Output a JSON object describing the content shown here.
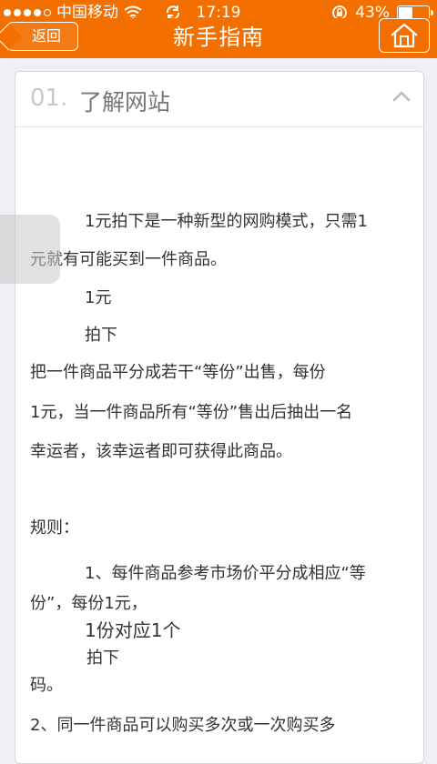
{
  "status_bar": {
    "carrier": "中国移动",
    "time": "17:19",
    "battery": "43%",
    "battery_level": 0.43
  },
  "navbar": {
    "back_label": "返回",
    "title": "新手指南",
    "home_icon": "home-icon"
  },
  "section": {
    "number": "01.",
    "title": "了解网站",
    "toggle_icon": "chevron-up-icon"
  },
  "content": {
    "p1_line1": "1元拍下是一种新型的网购模式，只需1",
    "p1_line2": "元就有可能买到一件商品。",
    "word_1yuan": "1元",
    "word_paixia": "拍下",
    "p2_line1": "把一件商品平分成若干“等份”出售，每份",
    "p2_line2": "1元，当一件商品所有“等份”售出后抽出一名",
    "p2_line3": "幸运者，该幸运者即可获得此商品。",
    "rules_label": "规则：",
    "r1_line1": "1、每件商品参考市场价平分成相应“等",
    "r1_line2": "份”，每份1元，",
    "r1_big": "1份对应1个",
    "r1_paixia": "拍下",
    "r1_ma": "码。",
    "r2_line1": "2、同一件商品可以购买多次或一次购买多"
  },
  "colors": {
    "brand": "#f26f00",
    "background": "#efeff4"
  }
}
